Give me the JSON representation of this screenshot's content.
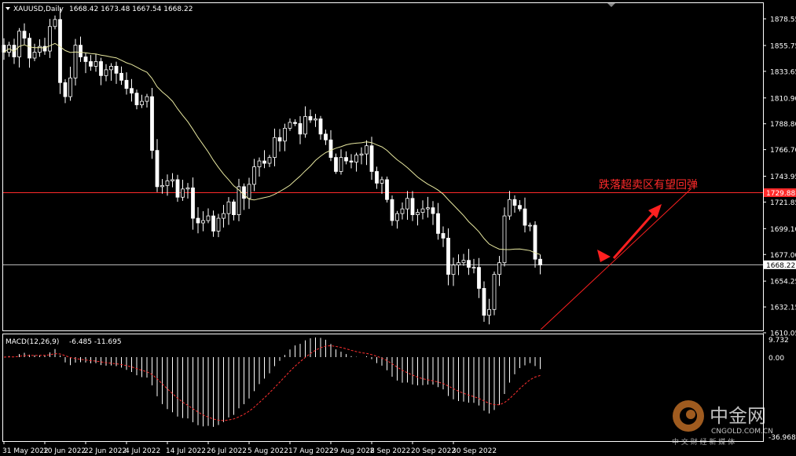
{
  "header": {
    "symbol": "XAUUSD,Daily",
    "ohlc": "1668.42 1673.48 1667.54 1668.22"
  },
  "macd": {
    "label": "MACD(12,26,9)",
    "values": "-6.485 -11.695",
    "price_labels": [
      "9.732",
      "0.00",
      "-36.968"
    ]
  },
  "annotation": {
    "text": "跌落超卖区有望回弹",
    "color": "#ff2a2a"
  },
  "watermark": {
    "brand": "中金网",
    "url": "CNGOLD.COM.CN",
    "sub": "中 文 财 经 新 媒 体"
  },
  "colors": {
    "background": "#000000",
    "axis": "#ffffff",
    "candle": "#ffffff",
    "ma": "#e8e8a0",
    "hline": "#ff2a2a",
    "price_line": "#c0c0c0",
    "signal": "#ff3030"
  },
  "chart_data": {
    "type": "candlestick",
    "title": "XAUUSD,Daily",
    "price_axis_labels": [
      1878.55,
      1855.75,
      1833.65,
      1810.9,
      1788.8,
      1766.7,
      1743.95,
      1721.85,
      1699.1,
      1677.0,
      1654.25,
      1632.15,
      1610.05
    ],
    "ylim": [
      1605,
      1890
    ],
    "date_labels": [
      "31 May 2022",
      "10 Jun 2022",
      "22 Jun 2022",
      "4 Jul 2022",
      "14 Jul 2022",
      "26 Jul 2022",
      "5 Aug 2022",
      "17 Aug 2022",
      "29 Aug 2022",
      "8 Sep 2022",
      "20 Sep 2022",
      "30 Sep 2022"
    ],
    "resistance_level": 1729.88,
    "current_price": 1668.22,
    "closes": [
      1850,
      1856,
      1846,
      1868,
      1862,
      1845,
      1850,
      1855,
      1851,
      1872,
      1878,
      1824,
      1812,
      1828,
      1856,
      1846,
      1842,
      1838,
      1842,
      1830,
      1835,
      1838,
      1832,
      1826,
      1819,
      1815,
      1805,
      1808,
      1812,
      1766,
      1735,
      1736,
      1740,
      1741,
      1726,
      1733,
      1734,
      1708,
      1704,
      1706,
      1710,
      1697,
      1708,
      1712,
      1722,
      1711,
      1735,
      1725,
      1737,
      1752,
      1757,
      1755,
      1760,
      1777,
      1774,
      1785,
      1790,
      1789,
      1780,
      1795,
      1792,
      1793,
      1780,
      1775,
      1760,
      1748,
      1760,
      1757,
      1756,
      1762,
      1763,
      1770,
      1748,
      1738,
      1741,
      1724,
      1706,
      1712,
      1716,
      1725,
      1711,
      1713,
      1716,
      1717,
      1712,
      1695,
      1691,
      1660,
      1668,
      1670,
      1672,
      1666,
      1666,
      1648,
      1625,
      1630,
      1660,
      1670,
      1710,
      1724,
      1719,
      1716,
      1702,
      1702,
      1673,
      1668
    ],
    "ma_reference": [
      {
        "date": "31 May 2022",
        "value": 1845
      },
      {
        "date": "22 Jun 2022",
        "value": 1838
      },
      {
        "date": "4 Jul 2022",
        "value": 1818
      },
      {
        "date": "14 Jul 2022",
        "value": 1781
      },
      {
        "date": "26 Jul 2022",
        "value": 1736
      },
      {
        "date": "5 Aug 2022",
        "value": 1752
      },
      {
        "date": "17 Aug 2022",
        "value": 1767
      },
      {
        "date": "29 Aug 2022",
        "value": 1748
      },
      {
        "date": "8 Sep 2022",
        "value": 1722
      },
      {
        "date": "20 Sep 2022",
        "value": 1690
      },
      {
        "date": "30 Sep 2022",
        "value": 1676
      }
    ],
    "macd_ylim": [
      -36.968,
      9.732
    ]
  }
}
